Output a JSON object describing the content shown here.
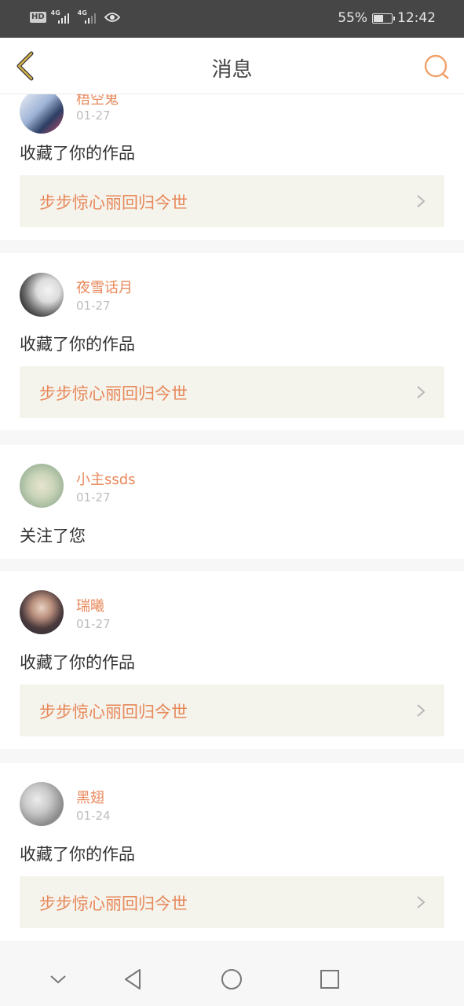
{
  "status_bar": {
    "hd": "HD",
    "net1": "4G",
    "net2": "4G",
    "battery": "55%",
    "battery_level": 0.55,
    "time": "12:42"
  },
  "header": {
    "title": "消息"
  },
  "colors": {
    "accent": "#e8885a",
    "back_arrow": "#c9a13c",
    "link_bg": "#f4f3ec"
  },
  "messages": [
    {
      "user": "梧空鬼",
      "date": "01-27",
      "action": "收藏了你的作品",
      "work": "步步惊心丽回归今世"
    },
    {
      "user": "夜雪话月",
      "date": "01-27",
      "action": "收藏了你的作品",
      "work": "步步惊心丽回归今世"
    },
    {
      "user": "小主ssds",
      "date": "01-27",
      "action": "关注了您",
      "work": null
    },
    {
      "user": "瑞曦",
      "date": "01-27",
      "action": "收藏了你的作品",
      "work": "步步惊心丽回归今世"
    },
    {
      "user": "黑翅",
      "date": "01-24",
      "action": "收藏了你的作品",
      "work": "步步惊心丽回归今世"
    }
  ]
}
